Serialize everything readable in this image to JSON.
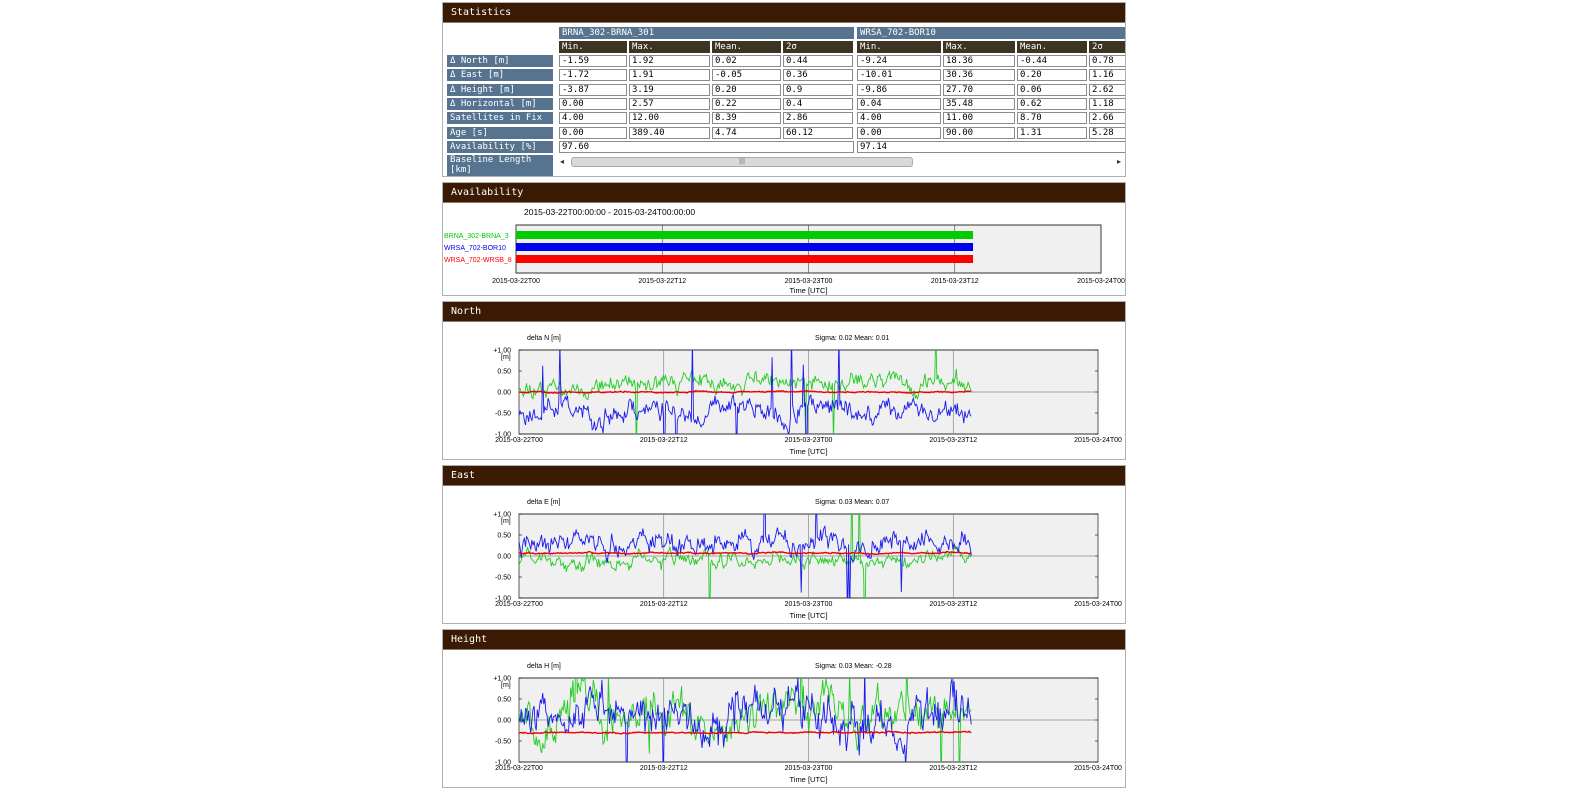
{
  "panels": {
    "statistics": "Statistics",
    "availability": "Availability",
    "north": "North",
    "east": "East",
    "height": "Height"
  },
  "stats": {
    "groups": [
      "BRNA_302-BRNA_301",
      "WRSA_702-BOR10"
    ],
    "columns": [
      "Min.",
      "Max.",
      "Mean.",
      "2σ"
    ],
    "rows": [
      {
        "label": "Δ North [m]",
        "g1": [
          "-1.59",
          "1.92",
          "0.02",
          "0.44"
        ],
        "g2": [
          "-9.24",
          "18.36",
          "-0.44",
          "0.78"
        ]
      },
      {
        "label": "Δ East [m]",
        "g1": [
          "-1.72",
          "1.91",
          "-0.05",
          "0.36"
        ],
        "g2": [
          "-10.01",
          "30.36",
          "0.20",
          "1.16"
        ]
      },
      {
        "label": "Δ Height [m]",
        "g1": [
          "-3.87",
          "3.19",
          "0.20",
          "0.9"
        ],
        "g2": [
          "-9.86",
          "27.70",
          "0.06",
          "2.62"
        ]
      },
      {
        "label": "Δ Horizontal [m]",
        "g1": [
          "0.00",
          "2.57",
          "0.22",
          "0.4"
        ],
        "g2": [
          "0.04",
          "35.48",
          "0.62",
          "1.18"
        ]
      },
      {
        "label": "Satellites in Fix",
        "g1": [
          "4.00",
          "12.00",
          "8.39",
          "2.86"
        ],
        "g2": [
          "4.00",
          "11.00",
          "8.70",
          "2.66"
        ]
      },
      {
        "label": "Age [s]",
        "g1": [
          "0.00",
          "389.40",
          "4.74",
          "60.12"
        ],
        "g2": [
          "0.00",
          "90.00",
          "1.31",
          "5.28"
        ]
      }
    ],
    "availability": {
      "label": "Availability [%]",
      "g1": "97.60",
      "g2": "97.14"
    },
    "baseline": {
      "label": "Baseline Length [km]"
    },
    "scroll_left": "◂",
    "scroll_right": "▸",
    "scroll_grip": "|||"
  },
  "availability_chart": {
    "range_text": "2015-03-22T00:00:00 - 2015-03-24T00:00:00",
    "series": [
      {
        "name": "BRNA_302-BRNA_3",
        "color": "#00cc00"
      },
      {
        "name": "WRSA_702-BOR10",
        "color": "#0000ee"
      },
      {
        "name": "WRSA_702-WRSB_8",
        "color": "#ff0000"
      }
    ],
    "x_ticks": [
      "2015-03-22T00",
      "2015-03-22T12",
      "2015-03-23T00",
      "2015-03-23T12",
      "2015-03-24T00"
    ],
    "xlabel": "Time [UTC]"
  },
  "chart_data": [
    {
      "type": "line",
      "title": "delta N [m]",
      "stats_text": "Sigma: 0.02 Mean: 0.01",
      "unit_label": "[m]",
      "y_ticks": [
        "+1.00",
        "0.50",
        "0.00",
        "-0.50",
        "-1.00"
      ],
      "ylim": [
        -1.0,
        1.0
      ],
      "x_ticks": [
        "2015-03-22T00",
        "2015-03-22T12",
        "2015-03-23T00",
        "2015-03-23T12",
        "2015-03-24T00"
      ],
      "xlabel": "Time [UTC]",
      "x_range_hours": [
        0,
        48
      ],
      "data_end_hours": 37.5,
      "grid": true,
      "series": [
        {
          "color": "#22cc22",
          "mean": 0.2,
          "noise": 0.25,
          "seed": 11
        },
        {
          "color": "#1a1aee",
          "mean": -0.45,
          "noise": 0.3,
          "seed": 23
        },
        {
          "color": "#ee0000",
          "mean": 0.0,
          "noise": 0.02,
          "seed": 5
        }
      ]
    },
    {
      "type": "line",
      "title": "delta E [m]",
      "stats_text": "Sigma: 0.03 Mean: 0.07",
      "unit_label": "[m]",
      "y_ticks": [
        "+1.00",
        "0.50",
        "0.00",
        "-0.50",
        "-1.00"
      ],
      "ylim": [
        -1.0,
        1.0
      ],
      "x_ticks": [
        "2015-03-22T00",
        "2015-03-22T12",
        "2015-03-23T00",
        "2015-03-23T12",
        "2015-03-24T00"
      ],
      "xlabel": "Time [UTC]",
      "x_range_hours": [
        0,
        48
      ],
      "data_end_hours": 37.5,
      "grid": true,
      "series": [
        {
          "color": "#22cc22",
          "mean": -0.1,
          "noise": 0.2,
          "seed": 31
        },
        {
          "color": "#1a1aee",
          "mean": 0.3,
          "noise": 0.3,
          "seed": 41
        },
        {
          "color": "#ee0000",
          "mean": 0.07,
          "noise": 0.02,
          "seed": 7
        }
      ]
    },
    {
      "type": "line",
      "title": "delta H [m]",
      "stats_text": "Sigma: 0.03 Mean: -0.28",
      "unit_label": "[m]",
      "y_ticks": [
        "+1.00",
        "0.50",
        "0.00",
        "-0.50",
        "-1.00"
      ],
      "ylim": [
        -1.0,
        1.0
      ],
      "x_ticks": [
        "2015-03-22T00",
        "2015-03-22T12",
        "2015-03-23T00",
        "2015-03-23T12",
        "2015-03-24T00"
      ],
      "xlabel": "Time [UTC]",
      "x_range_hours": [
        0,
        48
      ],
      "data_end_hours": 37.5,
      "grid": true,
      "series": [
        {
          "color": "#22cc22",
          "mean": 0.15,
          "noise": 0.55,
          "seed": 51
        },
        {
          "color": "#1a1aee",
          "mean": 0.05,
          "noise": 0.6,
          "seed": 61
        },
        {
          "color": "#ee0000",
          "mean": -0.3,
          "noise": 0.02,
          "seed": 9
        }
      ]
    }
  ]
}
